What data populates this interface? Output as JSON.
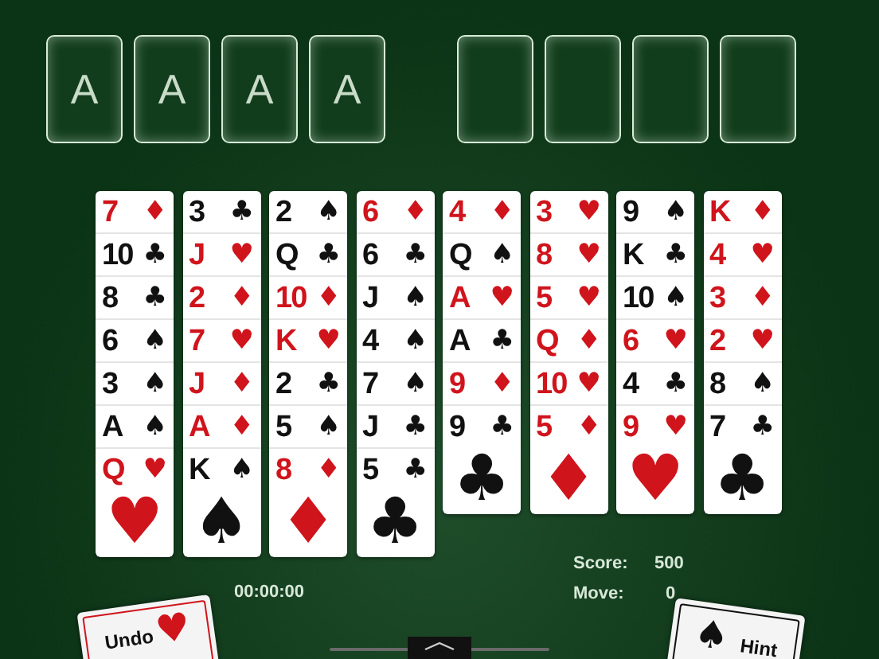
{
  "foundations": [
    {
      "label": "A"
    },
    {
      "label": "A"
    },
    {
      "label": "A"
    },
    {
      "label": "A"
    }
  ],
  "tableau": [
    {
      "cards": [
        {
          "rank": "7",
          "suit": "♦",
          "color": "#d0141c"
        },
        {
          "rank": "10",
          "suit": "♣",
          "color": "#111111"
        },
        {
          "rank": "8",
          "suit": "♣",
          "color": "#111111"
        },
        {
          "rank": "6",
          "suit": "♠",
          "color": "#111111"
        },
        {
          "rank": "3",
          "suit": "♠",
          "color": "#111111"
        },
        {
          "rank": "A",
          "suit": "♠",
          "color": "#111111"
        },
        {
          "rank": "Q",
          "suit": "♥",
          "color": "#d0141c"
        }
      ]
    },
    {
      "cards": [
        {
          "rank": "3",
          "suit": "♣",
          "color": "#111111"
        },
        {
          "rank": "J",
          "suit": "♥",
          "color": "#d0141c"
        },
        {
          "rank": "2",
          "suit": "♦",
          "color": "#d0141c"
        },
        {
          "rank": "7",
          "suit": "♥",
          "color": "#d0141c"
        },
        {
          "rank": "J",
          "suit": "♦",
          "color": "#d0141c"
        },
        {
          "rank": "A",
          "suit": "♦",
          "color": "#d0141c"
        },
        {
          "rank": "K",
          "suit": "♠",
          "color": "#111111"
        }
      ]
    },
    {
      "cards": [
        {
          "rank": "2",
          "suit": "♠",
          "color": "#111111"
        },
        {
          "rank": "Q",
          "suit": "♣",
          "color": "#111111"
        },
        {
          "rank": "10",
          "suit": "♦",
          "color": "#d0141c"
        },
        {
          "rank": "K",
          "suit": "♥",
          "color": "#d0141c"
        },
        {
          "rank": "2",
          "suit": "♣",
          "color": "#111111"
        },
        {
          "rank": "5",
          "suit": "♠",
          "color": "#111111"
        },
        {
          "rank": "8",
          "suit": "♦",
          "color": "#d0141c"
        }
      ]
    },
    {
      "cards": [
        {
          "rank": "6",
          "suit": "♦",
          "color": "#d0141c"
        },
        {
          "rank": "6",
          "suit": "♣",
          "color": "#111111"
        },
        {
          "rank": "J",
          "suit": "♠",
          "color": "#111111"
        },
        {
          "rank": "4",
          "suit": "♠",
          "color": "#111111"
        },
        {
          "rank": "7",
          "suit": "♠",
          "color": "#111111"
        },
        {
          "rank": "J",
          "suit": "♣",
          "color": "#111111"
        },
        {
          "rank": "5",
          "suit": "♣",
          "color": "#111111"
        }
      ]
    },
    {
      "cards": [
        {
          "rank": "4",
          "suit": "♦",
          "color": "#d0141c"
        },
        {
          "rank": "Q",
          "suit": "♠",
          "color": "#111111"
        },
        {
          "rank": "A",
          "suit": "♥",
          "color": "#d0141c"
        },
        {
          "rank": "A",
          "suit": "♣",
          "color": "#111111"
        },
        {
          "rank": "9",
          "suit": "♦",
          "color": "#d0141c"
        },
        {
          "rank": "9",
          "suit": "♣",
          "color": "#111111"
        }
      ]
    },
    {
      "cards": [
        {
          "rank": "3",
          "suit": "♥",
          "color": "#d0141c"
        },
        {
          "rank": "8",
          "suit": "♥",
          "color": "#d0141c"
        },
        {
          "rank": "5",
          "suit": "♥",
          "color": "#d0141c"
        },
        {
          "rank": "Q",
          "suit": "♦",
          "color": "#d0141c"
        },
        {
          "rank": "10",
          "suit": "♥",
          "color": "#d0141c"
        },
        {
          "rank": "5",
          "suit": "♦",
          "color": "#d0141c"
        }
      ]
    },
    {
      "cards": [
        {
          "rank": "9",
          "suit": "♠",
          "color": "#111111"
        },
        {
          "rank": "K",
          "suit": "♣",
          "color": "#111111"
        },
        {
          "rank": "10",
          "suit": "♠",
          "color": "#111111"
        },
        {
          "rank": "6",
          "suit": "♥",
          "color": "#d0141c"
        },
        {
          "rank": "4",
          "suit": "♣",
          "color": "#111111"
        },
        {
          "rank": "9",
          "suit": "♥",
          "color": "#d0141c"
        }
      ]
    },
    {
      "cards": [
        {
          "rank": "K",
          "suit": "♦",
          "color": "#d0141c"
        },
        {
          "rank": "4",
          "suit": "♥",
          "color": "#d0141c"
        },
        {
          "rank": "3",
          "suit": "♦",
          "color": "#d0141c"
        },
        {
          "rank": "2",
          "suit": "♥",
          "color": "#d0141c"
        },
        {
          "rank": "8",
          "suit": "♠",
          "color": "#111111"
        },
        {
          "rank": "7",
          "suit": "♣",
          "color": "#111111"
        }
      ]
    }
  ],
  "timer": "00:00:00",
  "score": {
    "label": "Score:",
    "value": "500"
  },
  "moves": {
    "label": "Move:",
    "value": "0"
  },
  "buttons": [
    {
      "label": "Undo",
      "suit": "♥",
      "color": "#d0141c"
    },
    {
      "label": "Hint",
      "suit": "♠",
      "color": "#111111"
    }
  ]
}
